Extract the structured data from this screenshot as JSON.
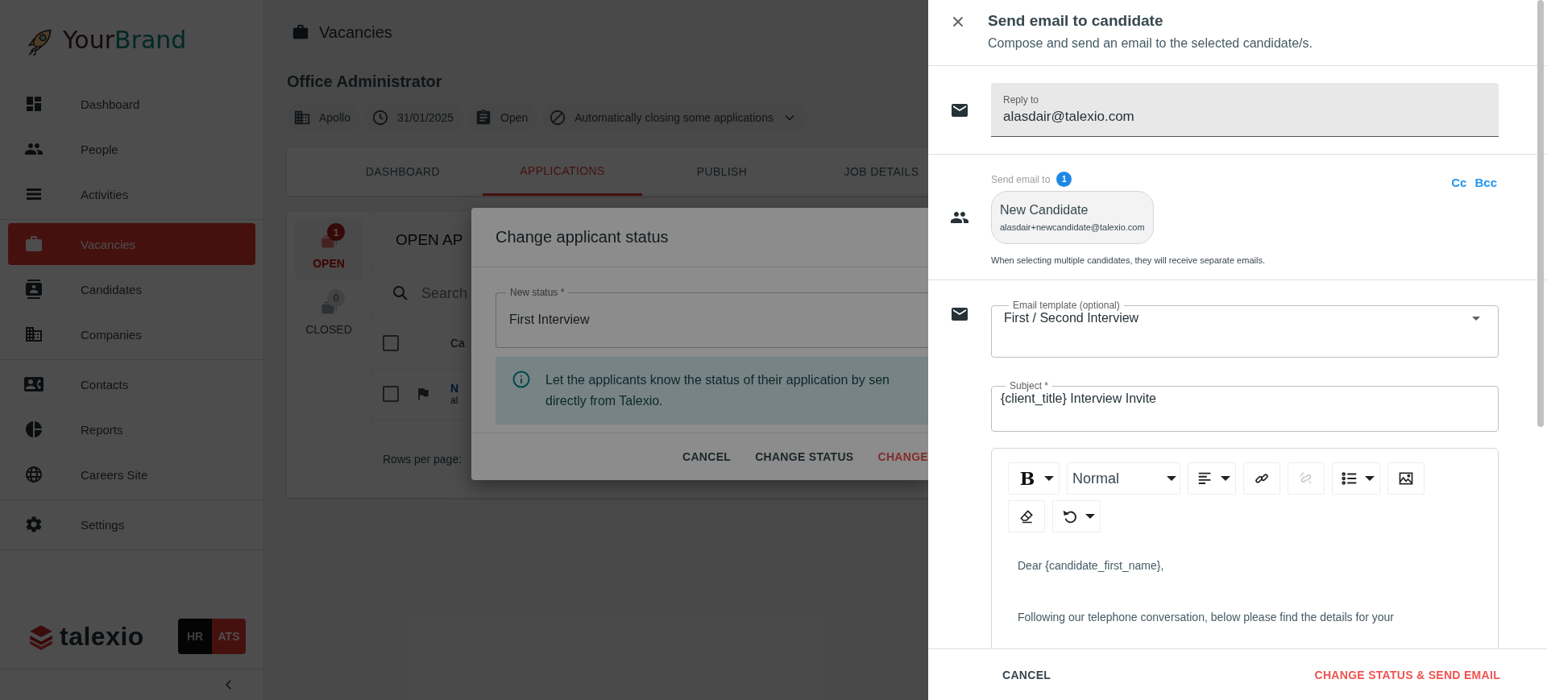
{
  "sidebar": {
    "brand": {
      "first": "Your",
      "second": "Brand"
    },
    "groups": [
      [
        {
          "label": "Dashboard",
          "selected": false
        },
        {
          "label": "People",
          "selected": false
        },
        {
          "label": "Activities",
          "selected": false
        }
      ],
      [
        {
          "label": "Vacancies",
          "selected": true
        },
        {
          "label": "Candidates",
          "selected": false
        },
        {
          "label": "Companies",
          "selected": false
        }
      ],
      [
        {
          "label": "Contacts",
          "selected": false
        },
        {
          "label": "Reports",
          "selected": false
        },
        {
          "label": "Careers Site",
          "selected": false
        }
      ],
      [
        {
          "label": "Settings",
          "selected": false
        }
      ]
    ],
    "product": "talexio",
    "modes": [
      {
        "label": "HR",
        "selected": false
      },
      {
        "label": "ATS",
        "selected": true
      }
    ]
  },
  "page": {
    "title": "Vacancies",
    "vacancy": "Office Administrator",
    "chips": [
      {
        "label": "Apollo",
        "dropdown": false
      },
      {
        "label": "31/01/2025",
        "dropdown": false
      },
      {
        "label": "Open",
        "dropdown": false
      },
      {
        "label": "Automatically closing some applications",
        "dropdown": true
      }
    ],
    "tabs": [
      {
        "label": "DASHBOARD",
        "selected": false
      },
      {
        "label": "APPLICATIONS",
        "selected": true
      },
      {
        "label": "PUBLISH",
        "selected": false
      },
      {
        "label": "JOB DETAILS",
        "selected": false
      }
    ],
    "filters": [
      {
        "label": "OPEN",
        "count": "1",
        "selected": true
      },
      {
        "label": "CLOSED",
        "count": "0",
        "selected": false
      }
    ],
    "list_heading": "OPEN AP",
    "search": {
      "placeholder": "Search"
    },
    "table": {
      "header": {
        "checked": false,
        "columns": [
          "Ca"
        ]
      },
      "rows": [
        {
          "checked": false,
          "flagged": true,
          "name": "N",
          "email": "al"
        }
      ]
    },
    "rows_per_page": "Rows per page:"
  },
  "modal": {
    "title": "Change applicant status",
    "field": {
      "label": "New status *",
      "value": "First Interview"
    },
    "info_lines": [
      "Let the applicants know the status of their application by sen",
      "directly from Talexio."
    ],
    "buttons": [
      {
        "label": "CANCEL",
        "primary": false
      },
      {
        "label": "CHANGE STATUS",
        "primary": false
      },
      {
        "label": "CHANGE",
        "primary": true
      }
    ]
  },
  "drawer": {
    "title": "Send email to candidate",
    "subtitle": "Compose and send an email to the selected candidate/s.",
    "reply_to": {
      "label": "Reply to",
      "value": "alasdair@talexio.com"
    },
    "recipients": {
      "label": "Send email to",
      "count": "1",
      "chips": [
        {
          "name": "New Candidate",
          "email": "alasdair+newcandidate@talexio.com"
        }
      ],
      "links": [
        "Cc",
        "Bcc"
      ],
      "hint": "When selecting multiple candidates, they will receive separate emails."
    },
    "template": {
      "label": "Email template (optional)",
      "value": "First / Second Interview"
    },
    "subject": {
      "label": "Subject *",
      "value": "{client_title} Interview Invite"
    },
    "toolbar": [
      [
        {
          "kind": "dropdown",
          "glyph": "B"
        },
        {
          "kind": "select",
          "value": "Normal"
        },
        {
          "kind": "dropdown"
        },
        {
          "kind": "button",
          "disabled": false
        },
        {
          "kind": "button",
          "disabled": true
        },
        {
          "kind": "dropdown"
        },
        {
          "kind": "button",
          "disabled": false
        }
      ],
      [
        {
          "kind": "button",
          "disabled": false
        },
        {
          "kind": "dropdown"
        }
      ]
    ],
    "body": [
      "Dear {candidate_first_name},",
      "Following our telephone conversation, below please find the details for your"
    ],
    "buttons": [
      {
        "label": "CANCEL",
        "primary": false
      },
      {
        "label": "CHANGE STATUS & SEND EMAIL",
        "primary": true
      }
    ]
  }
}
